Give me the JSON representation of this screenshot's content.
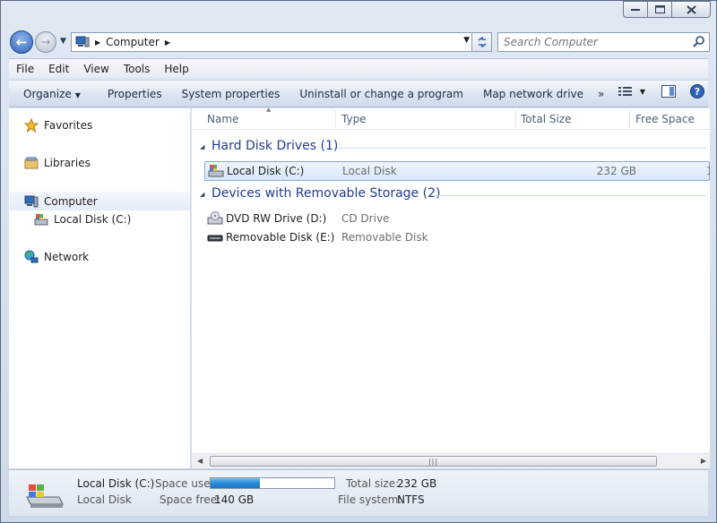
{
  "window": {
    "caption_buttons": [
      "minimize",
      "maximize",
      "close"
    ]
  },
  "nav": {
    "breadcrumb": [
      "Computer"
    ],
    "search_placeholder": "Search Computer"
  },
  "menu": [
    "File",
    "Edit",
    "View",
    "Tools",
    "Help"
  ],
  "toolbar": {
    "organize": "Organize",
    "properties": "Properties",
    "system_properties": "System properties",
    "uninstall": "Uninstall or change a program",
    "map_drive": "Map network drive",
    "more": "»"
  },
  "sidebar": {
    "favorites": "Favorites",
    "libraries": "Libraries",
    "computer": "Computer",
    "local_disk": "Local Disk (C:)",
    "network": "Network"
  },
  "columns": {
    "name": "Name",
    "type": "Type",
    "total_size": "Total Size",
    "free_space": "Free Space"
  },
  "groups": [
    {
      "title": "Hard Disk Drives (1)",
      "items": [
        {
          "name": "Local Disk (C:)",
          "type": "Local Disk",
          "total_size": "232 GB",
          "free_partial": "1"
        }
      ]
    },
    {
      "title": "Devices with Removable Storage (2)",
      "items": [
        {
          "name": "DVD RW Drive (D:)",
          "type": "CD Drive"
        },
        {
          "name": "Removable Disk (E:)",
          "type": "Removable Disk"
        }
      ]
    }
  ],
  "details": {
    "name": "Local Disk (C:)",
    "type": "Local Disk",
    "space_used_label": "Space used:",
    "space_used_fraction": 0.4,
    "space_free_label": "Space free:",
    "space_free": "140 GB",
    "total_label": "Total size:",
    "total": "232 GB",
    "fs_label": "File system:",
    "fs": "NTFS"
  },
  "colors": {
    "group_title": "#1e3d8f",
    "selection_border": "#84acdd",
    "usage_bar": "#2c8ad8"
  }
}
